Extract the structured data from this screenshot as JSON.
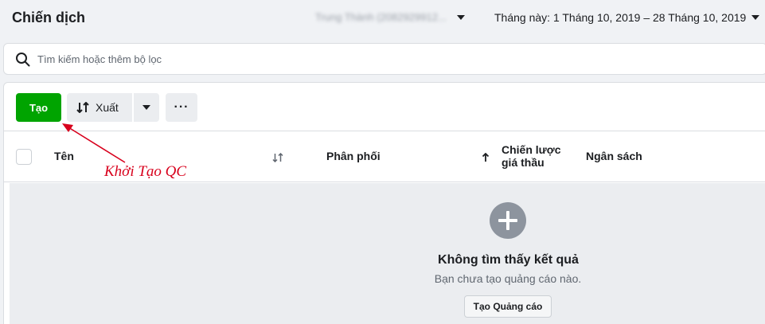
{
  "header": {
    "title": "Chiến dịch",
    "account": "Trung Thành (2082929912...",
    "date_range": "Tháng này: 1 Tháng 10, 2019 – 28 Tháng 10, 2019"
  },
  "search": {
    "placeholder": "Tìm kiếm hoặc thêm bộ lọc",
    "value": ""
  },
  "toolbar": {
    "create_label": "Tạo",
    "export_label": "Xuất",
    "more_label": "···"
  },
  "table": {
    "columns": [
      "Tên",
      "Phân phối",
      "Chiến lược giá thầu",
      "Ngân sách"
    ]
  },
  "empty_state": {
    "title": "Không tìm thấy kết quả",
    "subtitle": "Bạn chưa tạo quảng cáo nào.",
    "button_label": "Tạo Quảng cáo"
  },
  "annotation": {
    "text": "Khởi Tạo QC"
  },
  "colors": {
    "primary_green": "#00a400",
    "annotation_red": "#d8001c",
    "button_gray": "#ebedf0"
  },
  "icons": {
    "search": "search-icon",
    "export": "export-icon",
    "sort": "sort-icon",
    "plus": "plus-circle-icon"
  }
}
